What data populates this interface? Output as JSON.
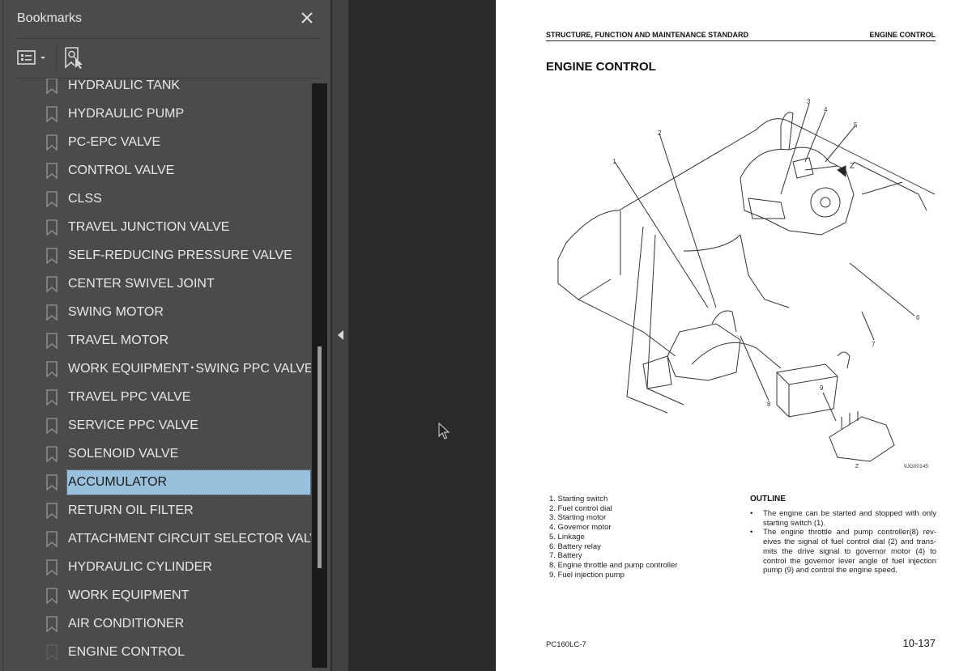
{
  "sidebar": {
    "title": "Bookmarks",
    "close_icon": "close-icon",
    "tools": {
      "options_icon": "list-options-icon",
      "find_icon": "find-current-bookmark-icon"
    },
    "items": [
      {
        "label": "HYDRAULIC TANK",
        "partial": true
      },
      {
        "label": "HYDRAULIC PUMP"
      },
      {
        "label": "PC-EPC VALVE"
      },
      {
        "label": "CONTROL VALVE"
      },
      {
        "label": "CLSS"
      },
      {
        "label": "TRAVEL JUNCTION VALVE"
      },
      {
        "label": "SELF-REDUCING PRESSURE VALVE"
      },
      {
        "label": "CENTER SWIVEL JOINT"
      },
      {
        "label": "SWING MOTOR"
      },
      {
        "label": "TRAVEL MOTOR"
      },
      {
        "label": "WORK EQUIPMENT･SWING PPC VALVE"
      },
      {
        "label": "TRAVEL PPC VALVE"
      },
      {
        "label": "SERVICE PPC VALVE"
      },
      {
        "label": "SOLENOID VALVE"
      },
      {
        "label": "ACCUMULATOR",
        "selected": true
      },
      {
        "label": "RETURN OIL FILTER"
      },
      {
        "label": "ATTACHMENT CIRCUIT SELECTOR VALVE"
      },
      {
        "label": "HYDRAULIC CYLINDER"
      },
      {
        "label": "WORK EQUIPMENT"
      },
      {
        "label": "AIR CONDITIONER"
      },
      {
        "label": "ENGINE CONTROL",
        "current": true
      }
    ],
    "scroll": {
      "thumb_start": 0.45,
      "thumb_end": 0.83
    },
    "selection_color": "#99c0dc"
  },
  "splitter": {
    "collapse_icon": "collapse-left-icon"
  },
  "document_page": {
    "header_left": "STRUCTURE, FUNCTION AND MAINTENANCE STANDARD",
    "header_right": "ENGINE CONTROL",
    "title": "ENGINE CONTROL",
    "figure": {
      "callouts": [
        "1",
        "2",
        "3",
        "4",
        "5",
        "6",
        "7",
        "8",
        "9"
      ],
      "view_label": "Z",
      "figure_id": "9JG00145"
    },
    "parts_list": [
      "1. Starting switch",
      "2. Fuel control dial",
      "3. Starting motor",
      "4. Govemor motor",
      "5. Linkage",
      "6. Battery relay",
      "7. Battery",
      "8. Engine throttle and pump controller",
      "9. Fuel injection pump"
    ],
    "outline": {
      "heading": "OUTLINE",
      "bullets": [
        "The engine can be started and stopped with only starting switch (1).",
        "The engine throttle and pump controller(8) rev-eives the signal of fuel control dial (2) and trans-mits the drive signal to governor motor (4) to control the govemor lever angle of fuel injection pump (9) and control the engine speed."
      ]
    },
    "footer_left": "PC160LC-7",
    "page_number": "10-137"
  }
}
